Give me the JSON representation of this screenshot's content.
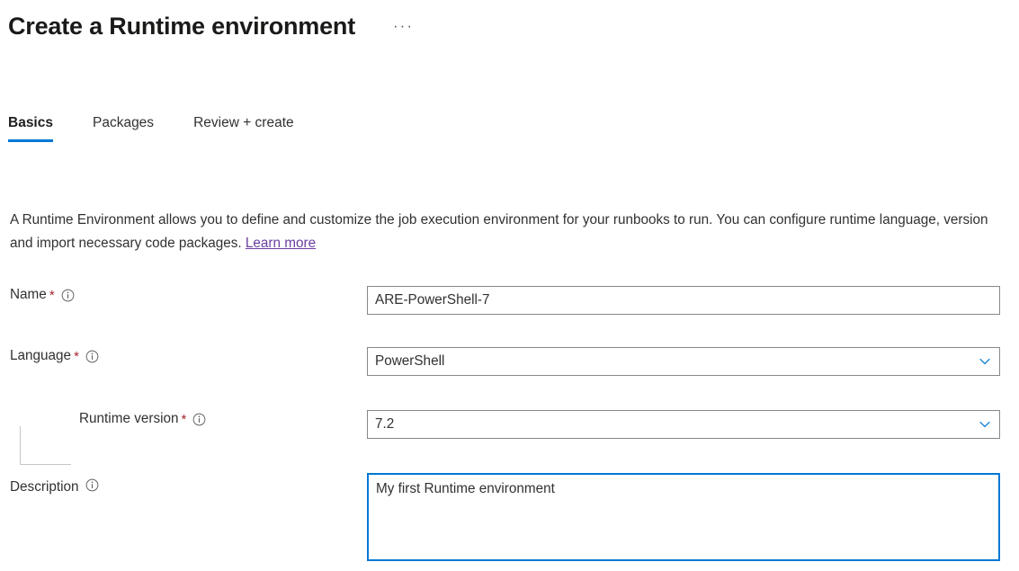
{
  "header": {
    "title": "Create a Runtime environment",
    "more_menu": "···",
    "more_menu_icon": "ellipsis-horizontal-icon"
  },
  "tabs": [
    {
      "label": "Basics",
      "active": true
    },
    {
      "label": "Packages",
      "active": false
    },
    {
      "label": "Review + create",
      "active": false
    }
  ],
  "intro": {
    "text": "A Runtime Environment allows you to define and customize the job execution environment for your runbooks to run. You can configure runtime language, version and import necessary code packages.",
    "link_label": "Learn more",
    "link_color": "#6b3fa0"
  },
  "form": {
    "name": {
      "label": "Name",
      "required_marker": "*",
      "info_icon": "info-circle-icon",
      "value": "ARE-PowerShell-7",
      "placeholder": ""
    },
    "language": {
      "label": "Language",
      "required_marker": "*",
      "info_icon": "info-circle-icon",
      "value": "PowerShell",
      "chevron_icon": "chevron-down-icon"
    },
    "runtime_version": {
      "label": "Runtime version",
      "required_marker": "*",
      "info_icon": "info-circle-icon",
      "value": "7.2",
      "chevron_icon": "chevron-down-icon"
    },
    "description": {
      "label": "Description",
      "info_icon": "info-circle-icon",
      "value": "My first Runtime environment",
      "placeholder": ""
    }
  },
  "colors": {
    "accent": "#0078d4",
    "required_star": "#a4262c",
    "border": "#8a8886",
    "text": "#323130"
  }
}
